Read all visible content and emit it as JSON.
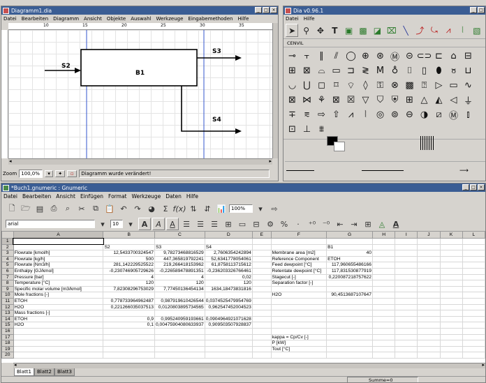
{
  "diagram_window": {
    "title": "Diagramm1.dia",
    "menus": [
      "Datei",
      "Bearbeiten",
      "Diagramm",
      "Ansicht",
      "Objekte",
      "Auswahl",
      "Werkzeuge",
      "Eingabemethoden",
      "Hilfe"
    ],
    "ruler_marks": [
      "10",
      "15",
      "20",
      "25",
      "30",
      "35"
    ],
    "block_label": "B1",
    "streams": {
      "s2": "S2",
      "s3": "S3",
      "s4": "S4"
    },
    "zoom_value": "100,0%",
    "status_text": "Diagramm wurde verändert!"
  },
  "toolbox_window": {
    "title": "Dia v0.96.1",
    "menus": [
      "Datei",
      "Hilfe"
    ],
    "sheet_name": "CENVIL"
  },
  "spreadsheet_window": {
    "title": "*Buch1.gnumeric : Gnumeric",
    "menus": [
      "Datei",
      "Bearbeiten",
      "Ansicht",
      "Einfügen",
      "Format",
      "Werkzeuge",
      "Daten",
      "Hilfe"
    ],
    "zoom": "100%",
    "font_name": "arial",
    "font_size": "10",
    "cell_ref": "A1",
    "columns": [
      "A",
      "B",
      "C",
      "D",
      "E",
      "F",
      "G",
      "H",
      "I",
      "J",
      "K",
      "L"
    ],
    "rows": [
      [
        "",
        "",
        "",
        "",
        "",
        "",
        "",
        "",
        "",
        "",
        "",
        ""
      ],
      [
        "",
        "S2",
        "S3",
        "S4",
        "",
        "",
        "B1",
        "",
        "",
        "",
        "",
        ""
      ],
      [
        "Flowrate [kmol/h]",
        "12,5433700324547",
        "9,78273468816529",
        "2,7606354242894",
        "",
        "Membrane area [m2]",
        "40",
        "",
        "",
        "",
        "",
        ""
      ],
      [
        "Flowrate [kg/h]",
        "500",
        "447,365819792241",
        "52,6341778054061",
        "",
        "Reference Component",
        "ETOH",
        "",
        "",
        "",
        "",
        ""
      ],
      [
        "Flowrate [Nm3/h]",
        "281,142229525522",
        "219,266418153962",
        "61,8758113715612",
        "",
        "Feed dewpoint [°C]",
        "117,960655486166",
        "",
        "",
        "",
        "",
        ""
      ],
      [
        "Enthalpy [GJ/kmol]",
        "-0,230746905729626",
        "-0,226589478891351",
        "-0,236203326766461",
        "",
        "Retentate dewpoint [°C]",
        "117,831530877919",
        "",
        "",
        "",
        "",
        ""
      ],
      [
        "Pressure [bar]",
        "4",
        "4",
        "0,02",
        "",
        "Stagecut [-]",
        "0,220087218757622",
        "",
        "",
        "",
        "",
        ""
      ],
      [
        "Temperature [°C]",
        "120",
        "120",
        "120",
        "",
        "Separation factor [-]",
        "",
        "",
        "",
        "",
        "",
        ""
      ],
      [
        "Specific molar volume [m3/kmol]",
        "7,82308296753029",
        "7,77450136454134",
        "1634,18473831816",
        "",
        "",
        "",
        "",
        "",
        "",
        "",
        ""
      ],
      [
        "Mole fractions [-]",
        "",
        "",
        "",
        "",
        "H2O",
        "90,4513687107647",
        "",
        "",
        "",
        "",
        ""
      ],
      [
        "ETOH",
        "0,778733964962487",
        "0,987919610426544",
        "0,0374525479954769",
        "",
        "",
        "",
        "",
        "",
        "",
        "",
        ""
      ],
      [
        "H2O",
        "0,221266035037513",
        "0,0120803895734565",
        "0,962547452004523",
        "",
        "",
        "",
        "",
        "",
        "",
        "",
        ""
      ],
      [
        "Mass fractions [-]",
        "",
        "",
        "",
        "",
        "",
        "",
        "",
        "",
        "",
        "",
        ""
      ],
      [
        "ETOH",
        "0,9",
        "0,995240959193661",
        "0,0904964921071628",
        "",
        "",
        "",
        "",
        "",
        "",
        "",
        ""
      ],
      [
        "H2O",
        "0,1",
        "0,00475904080633937",
        "0,909503507928837",
        "",
        "",
        "",
        "",
        "",
        "",
        "",
        ""
      ],
      [
        "",
        "",
        "",
        "",
        "",
        "",
        "",
        "",
        "",
        "",
        "",
        ""
      ],
      [
        "",
        "",
        "",
        "",
        "",
        "kappa = Cp/Cv [-]",
        "",
        "",
        "",
        "",
        "",
        ""
      ],
      [
        "",
        "",
        "",
        "",
        "",
        "P [kW]",
        "",
        "",
        "",
        "",
        "",
        ""
      ],
      [
        "",
        "",
        "",
        "",
        "",
        "Tout [°C]",
        "",
        "",
        "",
        "",
        "",
        ""
      ],
      [
        "",
        "",
        "",
        "",
        "",
        "",
        "",
        "",
        "",
        "",
        "",
        ""
      ]
    ],
    "sheet_tabs": [
      "Blatt1",
      "Blatt2",
      "Blatt3"
    ],
    "status_sum": "Summe=0"
  }
}
